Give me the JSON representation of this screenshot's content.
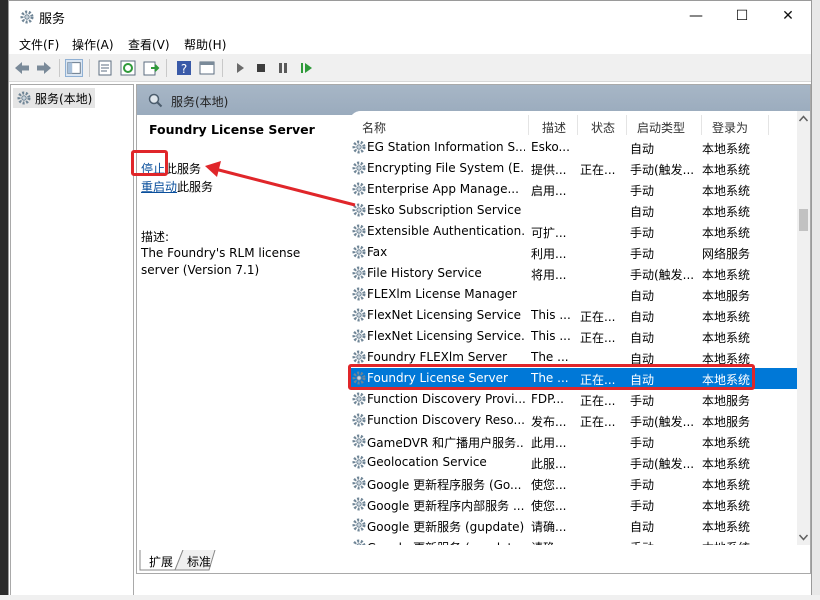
{
  "window": {
    "title": "服务",
    "controls": {
      "minimize": "—",
      "maximize": "☐",
      "close": "✕"
    }
  },
  "menu": [
    "文件(F)",
    "操作(A)",
    "查看(V)",
    "帮助(H)"
  ],
  "toolbar": {
    "icons": [
      "back-arrow-icon",
      "forward-arrow-icon",
      "show-hide-tree-icon",
      "properties-icon",
      "refresh-icon",
      "export-list-icon",
      "help-icon",
      "view-icon",
      "start-service-icon",
      "stop-service-icon",
      "pause-service-icon",
      "restart-service-icon"
    ]
  },
  "tree": {
    "item": "服务(本地)"
  },
  "header": {
    "title": "服务(本地)"
  },
  "details": {
    "service_name": "Foundry License Server",
    "stop_link": "停止",
    "stop_suffix": "此服务",
    "restart_link": "重启动",
    "restart_suffix": "此服务",
    "desc_label": "描述:",
    "desc_text": "The Foundry's RLM license server (Version 7.1)"
  },
  "columns": [
    "名称",
    "描述",
    "状态",
    "启动类型",
    "登录为"
  ],
  "rows": [
    {
      "name": "EG Station Information S...",
      "desc": "Esko...",
      "status": "",
      "startup": "自动",
      "logon": "本地系统"
    },
    {
      "name": "Encrypting File System (E...",
      "desc": "提供...",
      "status": "正在...",
      "startup": "手动(触发...",
      "logon": "本地系统"
    },
    {
      "name": "Enterprise App Manage...",
      "desc": "启用...",
      "status": "",
      "startup": "手动",
      "logon": "本地系统"
    },
    {
      "name": "Esko Subscription Service",
      "desc": "",
      "status": "",
      "startup": "自动",
      "logon": "本地系统"
    },
    {
      "name": "Extensible Authentication...",
      "desc": "可扩...",
      "status": "",
      "startup": "手动",
      "logon": "本地系统"
    },
    {
      "name": "Fax",
      "desc": "利用...",
      "status": "",
      "startup": "手动",
      "logon": "网络服务"
    },
    {
      "name": "File History Service",
      "desc": "将用...",
      "status": "",
      "startup": "手动(触发...",
      "logon": "本地系统"
    },
    {
      "name": "FLEXlm License Manager",
      "desc": "",
      "status": "",
      "startup": "自动",
      "logon": "本地服务"
    },
    {
      "name": "FlexNet Licensing Service",
      "desc": "This ...",
      "status": "正在...",
      "startup": "自动",
      "logon": "本地系统"
    },
    {
      "name": "FlexNet Licensing Service...",
      "desc": "This ...",
      "status": "正在...",
      "startup": "自动",
      "logon": "本地系统"
    },
    {
      "name": "Foundry FLEXlm Server",
      "desc": "The ...",
      "status": "",
      "startup": "自动",
      "logon": "本地系统"
    },
    {
      "name": "Foundry License Server",
      "desc": "The ...",
      "status": "正在...",
      "startup": "自动",
      "logon": "本地系统"
    },
    {
      "name": "Function Discovery Provi...",
      "desc": "FDP...",
      "status": "正在...",
      "startup": "手动",
      "logon": "本地服务"
    },
    {
      "name": "Function Discovery Reso...",
      "desc": "发布...",
      "status": "正在...",
      "startup": "手动(触发...",
      "logon": "本地服务"
    },
    {
      "name": "GameDVR 和广播用户服务...",
      "desc": "此用...",
      "status": "",
      "startup": "手动",
      "logon": "本地系统"
    },
    {
      "name": "Geolocation Service",
      "desc": "此服...",
      "status": "",
      "startup": "手动(触发...",
      "logon": "本地系统"
    },
    {
      "name": "Google 更新程序服务 (Go...",
      "desc": "使您...",
      "status": "",
      "startup": "手动",
      "logon": "本地系统"
    },
    {
      "name": "Google 更新程序内部服务 ...",
      "desc": "使您...",
      "status": "",
      "startup": "手动",
      "logon": "本地系统"
    },
    {
      "name": "Google 更新服务 (gupdate)",
      "desc": "请确...",
      "status": "",
      "startup": "自动",
      "logon": "本地系统"
    },
    {
      "name": "Google 更新服务 (gupdat...",
      "desc": "请确...",
      "status": "",
      "startup": "手动",
      "logon": "本地系统"
    }
  ],
  "selected_row": 11,
  "tabs": [
    "扩展",
    "标准"
  ],
  "accent_color": "#0078d7",
  "annotation_color": "#e0262a"
}
